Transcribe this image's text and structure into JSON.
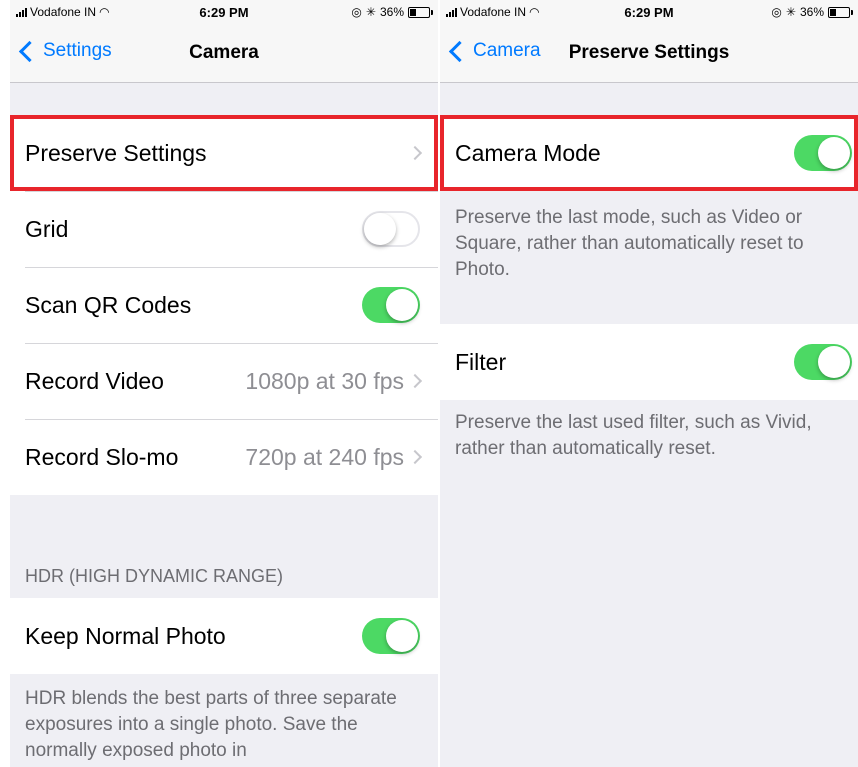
{
  "left": {
    "status": {
      "carrier": "Vodafone IN",
      "time": "6:29 PM",
      "battery": "36%"
    },
    "nav": {
      "back": "Settings",
      "title": "Camera"
    },
    "rows": [
      {
        "label": "Preserve Settings",
        "value": "",
        "control": "chevron",
        "highlighted": true
      },
      {
        "label": "Grid",
        "value": "",
        "control": "toggle",
        "on": false
      },
      {
        "label": "Scan QR Codes",
        "value": "",
        "control": "toggle",
        "on": true
      },
      {
        "label": "Record Video",
        "value": "1080p at 30 fps",
        "control": "chevron"
      },
      {
        "label": "Record Slo-mo",
        "value": "720p at 240 fps",
        "control": "chevron"
      }
    ],
    "hdr_header": "HDR (HIGH DYNAMIC RANGE)",
    "hdr_row": {
      "label": "Keep Normal Photo",
      "on": true
    },
    "hdr_footer": "HDR blends the best parts of three separate exposures into a single photo. Save the normally exposed photo in"
  },
  "right": {
    "status": {
      "carrier": "Vodafone IN",
      "time": "6:29 PM",
      "battery": "36%"
    },
    "nav": {
      "back": "Camera",
      "title": "Preserve Settings"
    },
    "camera_mode": {
      "label": "Camera Mode",
      "on": true,
      "highlighted": true
    },
    "camera_mode_footer": "Preserve the last mode, such as Video or Square, rather than automatically reset to Photo.",
    "filter": {
      "label": "Filter",
      "on": true
    },
    "filter_footer": "Preserve the last used filter, such as Vivid, rather than automatically reset."
  },
  "colors": {
    "accent": "#007aff",
    "toggle_on": "#4cd964",
    "highlight": "#e8252b"
  }
}
